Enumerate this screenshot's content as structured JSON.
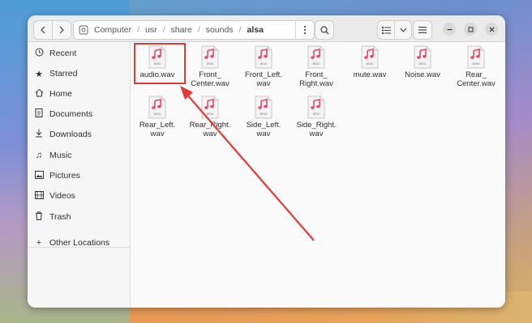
{
  "colors": {
    "accent_red": "#e53935",
    "music_red": "#e8476a"
  },
  "header": {
    "back_icon": "chevron-left-icon",
    "forward_icon": "chevron-right-icon",
    "path": [
      "Computer",
      "usr",
      "share",
      "sounds",
      "alsa"
    ],
    "path_separator": "/",
    "path_menu_icon": "vertical-dots-icon",
    "search_icon": "search-icon",
    "view_icon": "list-view-icon",
    "view_dropdown_icon": "chevron-down-icon",
    "menu_icon": "hamburger-menu-icon",
    "minimize_icon": "minimize-icon",
    "maximize_icon": "maximize-icon",
    "close_icon": "close-icon"
  },
  "sidebar": {
    "items": [
      {
        "label": "Recent",
        "icon": "clock-icon"
      },
      {
        "label": "Starred",
        "icon": "star-icon"
      },
      {
        "label": "Home",
        "icon": "home-icon"
      },
      {
        "label": "Documents",
        "icon": "document-icon"
      },
      {
        "label": "Downloads",
        "icon": "download-icon"
      },
      {
        "label": "Music",
        "icon": "music-note-icon"
      },
      {
        "label": "Pictures",
        "icon": "image-icon"
      },
      {
        "label": "Videos",
        "icon": "film-icon"
      },
      {
        "label": "Trash",
        "icon": "trash-icon"
      },
      {
        "label": "Other Locations",
        "icon": "plus-icon"
      }
    ]
  },
  "files": [
    {
      "line1": "audio.wav",
      "line2": "",
      "ext": "wav",
      "highlighted": true
    },
    {
      "line1": "Front_",
      "line2": "Center.wav",
      "ext": "wav"
    },
    {
      "line1": "Front_Left.",
      "line2": "wav",
      "ext": "wav"
    },
    {
      "line1": "Front_",
      "line2": "Right.wav",
      "ext": "wav"
    },
    {
      "line1": "mute.wav",
      "line2": "",
      "ext": "wav"
    },
    {
      "line1": "Noise.wav",
      "line2": "",
      "ext": "wav"
    },
    {
      "line1": "Rear_",
      "line2": "Center.wav",
      "ext": "wav"
    },
    {
      "line1": "Rear_Left.",
      "line2": "wav",
      "ext": "wav"
    },
    {
      "line1": "Rear_Right.",
      "line2": "wav",
      "ext": "wav"
    },
    {
      "line1": "Side_Left.",
      "line2": "wav",
      "ext": "wav"
    },
    {
      "line1": "Side_Right.",
      "line2": "wav",
      "ext": "wav"
    }
  ]
}
